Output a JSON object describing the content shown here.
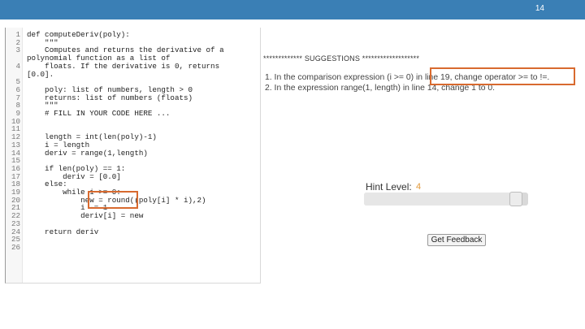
{
  "slide": {
    "number": "14"
  },
  "colors": {
    "header_bar": "#3a7fb5",
    "highlight": "#d86a2f",
    "hint_value": "#e39a3a"
  },
  "code": {
    "lines": [
      {
        "n": "1",
        "text": "def computeDeriv(poly):"
      },
      {
        "n": "2",
        "text": "    \"\"\""
      },
      {
        "n": "3",
        "text": "    Computes and returns the derivative of a"
      },
      {
        "n": "",
        "text": "polynomial function as a list of"
      },
      {
        "n": "4",
        "text": "    floats. If the derivative is 0, returns"
      },
      {
        "n": "",
        "text": "[0.0]."
      },
      {
        "n": "5",
        "text": ""
      },
      {
        "n": "6",
        "text": "    poly: list of numbers, length > 0"
      },
      {
        "n": "7",
        "text": "    returns: list of numbers (floats)"
      },
      {
        "n": "8",
        "text": "    \"\"\""
      },
      {
        "n": "9",
        "text": "    # FILL IN YOUR CODE HERE ..."
      },
      {
        "n": "10",
        "text": ""
      },
      {
        "n": "11",
        "text": ""
      },
      {
        "n": "12",
        "text": "    length = int(len(poly)-1)"
      },
      {
        "n": "13",
        "text": "    i = length"
      },
      {
        "n": "14",
        "text": "    deriv = range(1,length)"
      },
      {
        "n": "15",
        "text": ""
      },
      {
        "n": "16",
        "text": "    if len(poly) == 1:"
      },
      {
        "n": "17",
        "text": "        deriv = [0.0]"
      },
      {
        "n": "18",
        "text": "    else:"
      },
      {
        "n": "19",
        "text": "        while i >= 0:"
      },
      {
        "n": "20",
        "text": "            new = round((poly[i] * i),2)"
      },
      {
        "n": "21",
        "text": "            i -= 1"
      },
      {
        "n": "22",
        "text": "            deriv[i] = new"
      },
      {
        "n": "23",
        "text": ""
      },
      {
        "n": "24",
        "text": "    return deriv"
      },
      {
        "n": "25",
        "text": ""
      },
      {
        "n": "26",
        "text": ""
      }
    ]
  },
  "suggestions": {
    "header": "************* SUGGESTIONS *******************",
    "items": [
      "1. In the comparison expression (i >= 0) in line 19, change operator >= to !=.",
      "2. In the expression range(1, length) in line 14, change 1 to 0."
    ]
  },
  "hint": {
    "label": "Hint Level:",
    "value": "4",
    "level_fraction": 0.96
  },
  "feedback_button": {
    "label": "Get Feedback"
  }
}
